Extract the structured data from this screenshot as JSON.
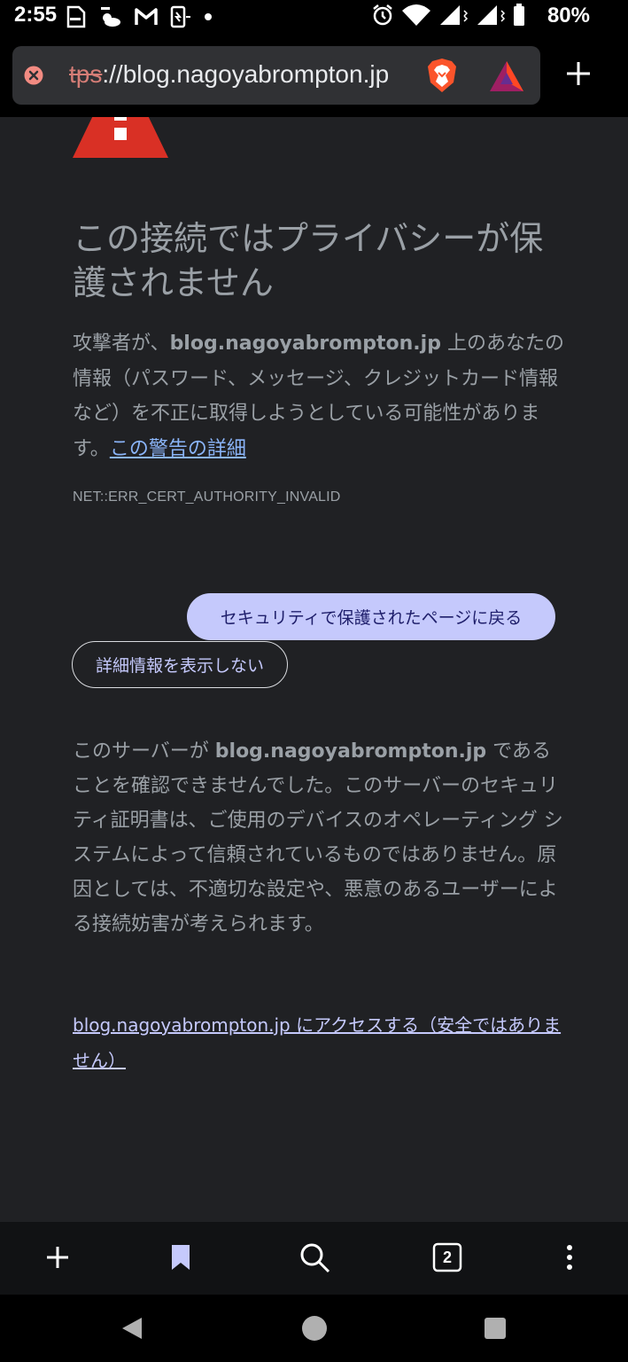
{
  "status_bar": {
    "time": "2:55",
    "left_icons": [
      "document-icon",
      "weather-icon",
      "gmail-icon",
      "screen-cast-icon",
      "dot-icon"
    ],
    "right_icons": [
      "alarm-icon",
      "wifi-icon",
      "cell-signal-icon",
      "cell-signal-icon",
      "battery-icon"
    ],
    "battery": "80%"
  },
  "url_bar": {
    "scheme_struck": "tps",
    "rest": "://blog.nagoyabrompton.jp",
    "security_icon": "not-secure-icon",
    "brave_icon": "brave-shields-icon",
    "rewards_icon": "brave-rewards-icon",
    "new_tab_icon": "plus-icon"
  },
  "page": {
    "heading": "この接続ではプライバシーが保護されません",
    "para1_before": "攻撃者が、",
    "para1_host": "blog.nagoyabrompton.jp",
    "para1_after": " 上のあなたの情報（パスワード、メッセージ、クレジットカード情報など）を不正に取得しようとしている可能性があります。",
    "learn_more": "この警告の詳細",
    "error_code": "NET::ERR_CERT_AUTHORITY_INVALID",
    "back_button": "セキュリティで保護されたページに戻る",
    "details_button": "詳細情報を表示しない",
    "para2_before": "このサーバーが ",
    "para2_host": "blog.nagoyabrompton.jp",
    "para2_after": " であることを確認できませんでした。このサーバーのセキュリティ証明書は、ご使用のデバイスのオペレーティング システムによって信頼されているものではありません。原因としては、不適切な設定や、悪意のあるユーザーによる接続妨害が考えられます。",
    "proceed_link": "blog.nagoyabrompton.jp にアクセスする（安全ではありません）"
  },
  "bottom_bar": {
    "icons": [
      "plus-icon",
      "bookmark-icon",
      "search-icon",
      "tab-count-icon",
      "more-vert-icon"
    ],
    "tab_count": "2"
  },
  "nav_bar": {
    "icons": [
      "back-icon",
      "home-icon",
      "recents-icon"
    ]
  },
  "colors": {
    "background": "#202124",
    "text": "#9aa0a6",
    "accent": "#c5c9fc",
    "warning_red": "#d93025"
  }
}
